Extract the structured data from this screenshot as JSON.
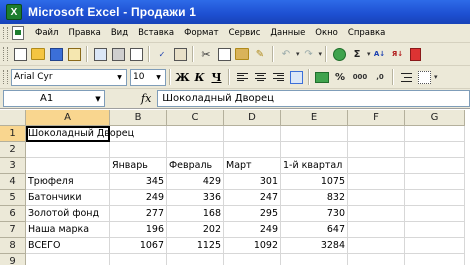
{
  "window": {
    "title": "Microsoft Excel - Продажи 1",
    "app_icon_letter": "X"
  },
  "menu": [
    "Файл",
    "Правка",
    "Вид",
    "Вставка",
    "Формат",
    "Сервис",
    "Данные",
    "Окно",
    "Справка"
  ],
  "toolbar_format": {
    "font_name": "Arial Cyr",
    "font_size": "10",
    "bold": "Ж",
    "italic": "К",
    "underline": "Ч",
    "percent": "%",
    "thousands": "000",
    "dec_inc": ",0",
    "sum_symbol": "Σ",
    "zoom_arrow": "▾"
  },
  "formula_bar": {
    "cell_ref": "A1",
    "fx": "fx",
    "content": "Шоколадный Дворец"
  },
  "columns": [
    "A",
    "B",
    "C",
    "D",
    "E",
    "F",
    "G"
  ],
  "rows": [
    "1",
    "2",
    "3",
    "4",
    "5",
    "6",
    "7",
    "8",
    "9"
  ],
  "cells": {
    "A1": "Шоколадный Дворец",
    "B3": "Январь",
    "C3": "Февраль",
    "D3": "Март",
    "E3": "1-й квартал",
    "A4": "Трюфеля",
    "B4": "345",
    "C4": "429",
    "D4": "301",
    "E4": "1075",
    "A5": "Батончики",
    "B5": "249",
    "C5": "336",
    "D5": "247",
    "E5": "832",
    "A6": "Золотой фонд",
    "B6": "277",
    "C6": "168",
    "D6": "295",
    "E6": "730",
    "A7": "Наша марка",
    "B7": "196",
    "C7": "202",
    "D7": "249",
    "E7": "647",
    "A8": "ВСЕГО",
    "B8": "1067",
    "C8": "1125",
    "D8": "1092",
    "E8": "3284"
  }
}
